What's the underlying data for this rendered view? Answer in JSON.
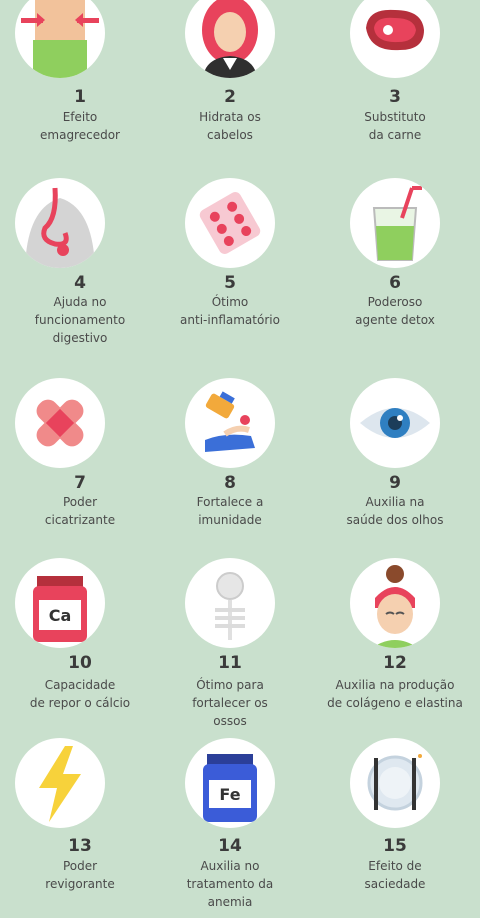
{
  "benefits": [
    {
      "number": "1",
      "line1": "Efeito",
      "line2": "emagrecedor",
      "line3": "",
      "icon": "waist-slimming-icon"
    },
    {
      "number": "2",
      "line1": "Hidrata os",
      "line2": "cabelos",
      "line3": "",
      "icon": "woman-hair-icon"
    },
    {
      "number": "3",
      "line1": "Substituto",
      "line2": "da carne",
      "line3": "",
      "icon": "steak-icon"
    },
    {
      "number": "4",
      "line1": "Ajuda no",
      "line2": "funcionamento",
      "line3": "digestivo",
      "icon": "digestive-system-icon"
    },
    {
      "number": "5",
      "line1": "Ótimo",
      "line2": "anti-inflamatório",
      "line3": "",
      "icon": "pill-pack-icon"
    },
    {
      "number": "6",
      "line1": "Poderoso",
      "line2": "agente detox",
      "line3": "",
      "icon": "green-juice-icon"
    },
    {
      "number": "7",
      "line1": "Poder",
      "line2": "cicatrizante",
      "line3": "",
      "icon": "bandage-icon"
    },
    {
      "number": "8",
      "line1": "Fortalece a",
      "line2": "imunidade",
      "line3": "",
      "icon": "medicine-hand-icon"
    },
    {
      "number": "9",
      "line1": "Auxilia na",
      "line2": "saúde dos olhos",
      "line3": "",
      "icon": "eye-icon"
    },
    {
      "number": "10",
      "line1": "Capacidade",
      "line2": "de repor o cálcio",
      "line3": "",
      "icon": "calcium-jar-icon"
    },
    {
      "number": "11",
      "line1": "Ótimo para",
      "line2": "fortalecer os",
      "line3": "ossos",
      "icon": "skeleton-icon"
    },
    {
      "number": "12",
      "line1": "Auxilia na produção",
      "line2": "de colágeno e elastina",
      "line3": "",
      "icon": "woman-face-icon"
    },
    {
      "number": "13",
      "line1": "Poder",
      "line2": "revigorante",
      "line3": "",
      "icon": "lightning-icon"
    },
    {
      "number": "14",
      "line1": "Auxilia no",
      "line2": "tratamento da",
      "line3": "anemia",
      "icon": "iron-jar-icon"
    },
    {
      "number": "15",
      "line1": "Efeito de",
      "line2": "saciedade",
      "line3": "",
      "icon": "plate-cutlery-icon"
    }
  ],
  "jar_labels": {
    "calcium": "Ca",
    "iron": "Fe"
  },
  "colors": {
    "background": "#c9e0cd",
    "pink": "#e8435c",
    "green": "#7bc56a",
    "text": "#4a4a4a"
  }
}
